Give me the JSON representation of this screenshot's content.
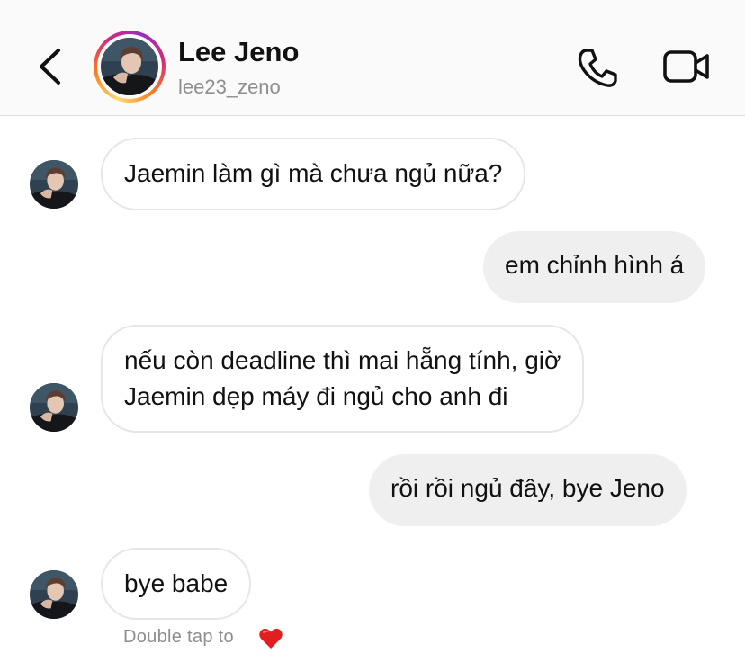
{
  "header": {
    "name": "Lee Jeno",
    "username": "lee23_zeno",
    "icons": {
      "back": "chevron-left-icon",
      "call": "phone-icon",
      "video": "video-camera-icon"
    }
  },
  "messages": [
    {
      "from": "them",
      "text": "Jaemin làm gì mà chưa ngủ nữa?"
    },
    {
      "from": "me",
      "text": "em chỉnh hình á"
    },
    {
      "from": "them",
      "lines": [
        "nếu còn deadline thì mai hẵng tính, giờ",
        "Jaemin dẹp máy đi ngủ cho anh đi"
      ]
    },
    {
      "from": "me",
      "text": "rồi rồi ngủ đây, bye Jeno"
    },
    {
      "from": "them",
      "text": "bye babe"
    }
  ],
  "reaction_hint": {
    "text": "Double tap to",
    "emoji": "heart-icon",
    "color": "#e02020"
  },
  "colors": {
    "header_bg": "#fafafa",
    "incoming_border": "#e6e6e6",
    "outgoing_bg": "#efefef",
    "secondary_text": "#8e8e8e"
  }
}
